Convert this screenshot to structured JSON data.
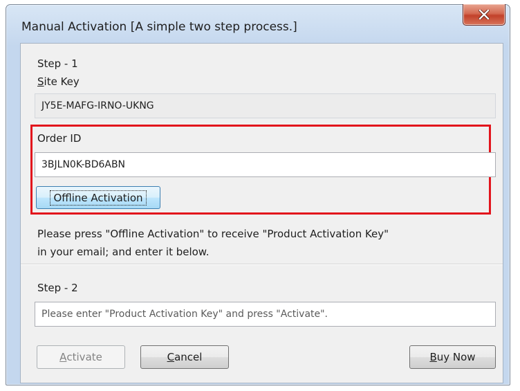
{
  "window": {
    "title": "Manual Activation [A simple two step process.]"
  },
  "step1": {
    "heading": "Step - 1",
    "site_key_label": {
      "mnemonic": "S",
      "rest": "ite Key"
    },
    "site_key_value": "JY5E-MAFG-IRNO-UKNG",
    "order_id_label": "Order ID",
    "order_id_value": "3BJLN0K-BD6ABN",
    "offline_button": "Offline Activation",
    "instructions_line1": "Please press \"Offline Activation\" to receive \"Product Activation Key\"",
    "instructions_line2": "in your email; and enter it below."
  },
  "step2": {
    "heading": "Step - 2",
    "activation_key_placeholder": "Please enter \"Product Activation Key\" and press \"Activate\"."
  },
  "buttons": {
    "activate": {
      "mnemonic": "A",
      "rest": "ctivate",
      "enabled": false
    },
    "cancel": {
      "mnemonic": "C",
      "rest": "ancel"
    },
    "buy_now": {
      "mnemonic": "B",
      "rest": "uy Now"
    }
  },
  "colors": {
    "highlight_border": "#e2141c",
    "close_button": "#c2412a",
    "dialog_background": "#f0f0f0",
    "frame": "#c4d7ee"
  },
  "icons": {
    "close": "close-icon"
  }
}
